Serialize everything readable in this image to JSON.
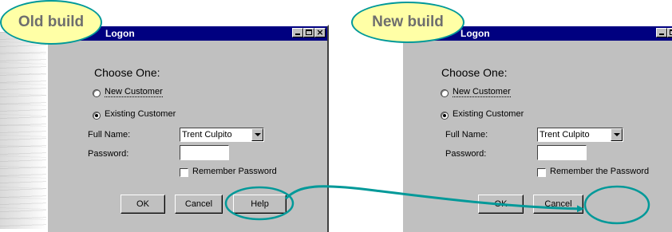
{
  "annotations": {
    "old_label": "Old build",
    "new_label": "New build"
  },
  "old_window": {
    "title": "Logon",
    "heading": "Choose One:",
    "radio_new_label": "New Customer",
    "radio_existing_label": "Existing Customer",
    "full_name_label": "Full Name:",
    "full_name_value": "Trent Culpito",
    "password_label": "Password:",
    "remember_label": "Remember Password",
    "ok_label": "OK",
    "cancel_label": "Cancel",
    "help_label": "Help"
  },
  "new_window": {
    "title": "Logon",
    "heading": "Choose One:",
    "radio_new_label": "New Customer",
    "radio_existing_label": "Existing Customer",
    "full_name_label": "Full Name:",
    "full_name_value": "Trent Culpito",
    "password_label": "Password:",
    "remember_label": "Remember the Password",
    "ok_label": "OK",
    "cancel_label": "Cancel"
  },
  "colors": {
    "titlebar": "#000080",
    "window_bg": "#c0c0c0",
    "callout_fill": "#ffffa6",
    "annotation_stroke": "#009999"
  }
}
